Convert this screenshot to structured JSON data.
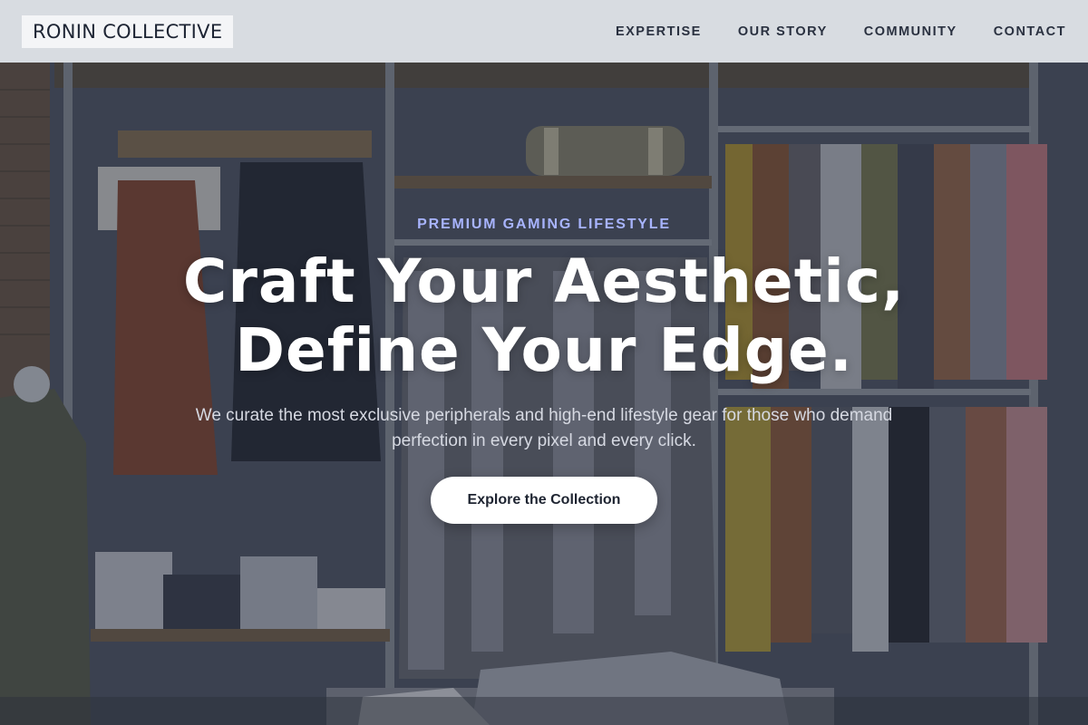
{
  "brand": {
    "name": "RONIN COLLECTIVE"
  },
  "nav": {
    "items": [
      {
        "label": "EXPERTISE"
      },
      {
        "label": "OUR STORY"
      },
      {
        "label": "COMMUNITY"
      },
      {
        "label": "CONTACT"
      }
    ]
  },
  "hero": {
    "eyebrow": "PREMIUM GAMING LIFESTYLE",
    "headline_line1": "Craft Your Aesthetic,",
    "headline_line2": "Define Your Edge.",
    "subcopy": "We curate the most exclusive peripherals and high-end lifestyle gear for those who demand perfection in every pixel and every click.",
    "cta_label": "Explore the Collection",
    "background_image": "clothing-store-interior"
  },
  "colors": {
    "header_bg": "#e0e3e8",
    "eyebrow": "#a8b4ff",
    "headline": "#ffffff",
    "cta_bg": "#ffffff",
    "cta_text": "#1e2431"
  }
}
